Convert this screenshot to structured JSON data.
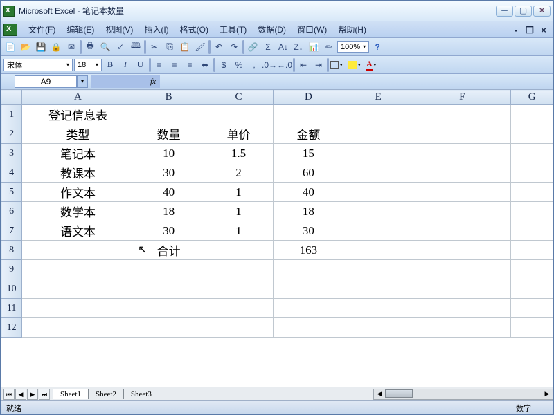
{
  "titlebar": {
    "app": "Microsoft Excel",
    "doc": "笔记本数量",
    "sep": " - "
  },
  "menu": {
    "items": [
      "文件(F)",
      "编辑(E)",
      "视图(V)",
      "插入(I)",
      "格式(O)",
      "工具(T)",
      "数据(D)",
      "窗口(W)",
      "帮助(H)"
    ]
  },
  "toolbar": {
    "zoom": "100%"
  },
  "format": {
    "font": "宋体",
    "size": "18"
  },
  "namebox": "A9",
  "fx": "fx",
  "columns": [
    "A",
    "B",
    "C",
    "D",
    "E",
    "F",
    "G"
  ],
  "rows": [
    "1",
    "2",
    "3",
    "4",
    "5",
    "6",
    "7",
    "8",
    "9",
    "10",
    "11",
    "12"
  ],
  "cells": {
    "A1": "登记信息表",
    "A2": "类型",
    "B2": "数量",
    "C2": "单价",
    "D2": "金额",
    "A3": "笔记本",
    "B3": "10",
    "C3": "1.5",
    "D3": "15",
    "A4": "教课本",
    "B4": "30",
    "C4": "2",
    "D4": "60",
    "A5": "作文本",
    "B5": "40",
    "C5": "1",
    "D5": "40",
    "A6": "数学本",
    "B6": "18",
    "C6": "1",
    "D6": "18",
    "A7": "语文本",
    "B7": "30",
    "C7": "1",
    "D7": "30",
    "B8": "合计",
    "D8": "163"
  },
  "tabs": [
    "Sheet1",
    "Sheet2",
    "Sheet3"
  ],
  "status": {
    "ready": "就绪",
    "mode": "数字"
  }
}
